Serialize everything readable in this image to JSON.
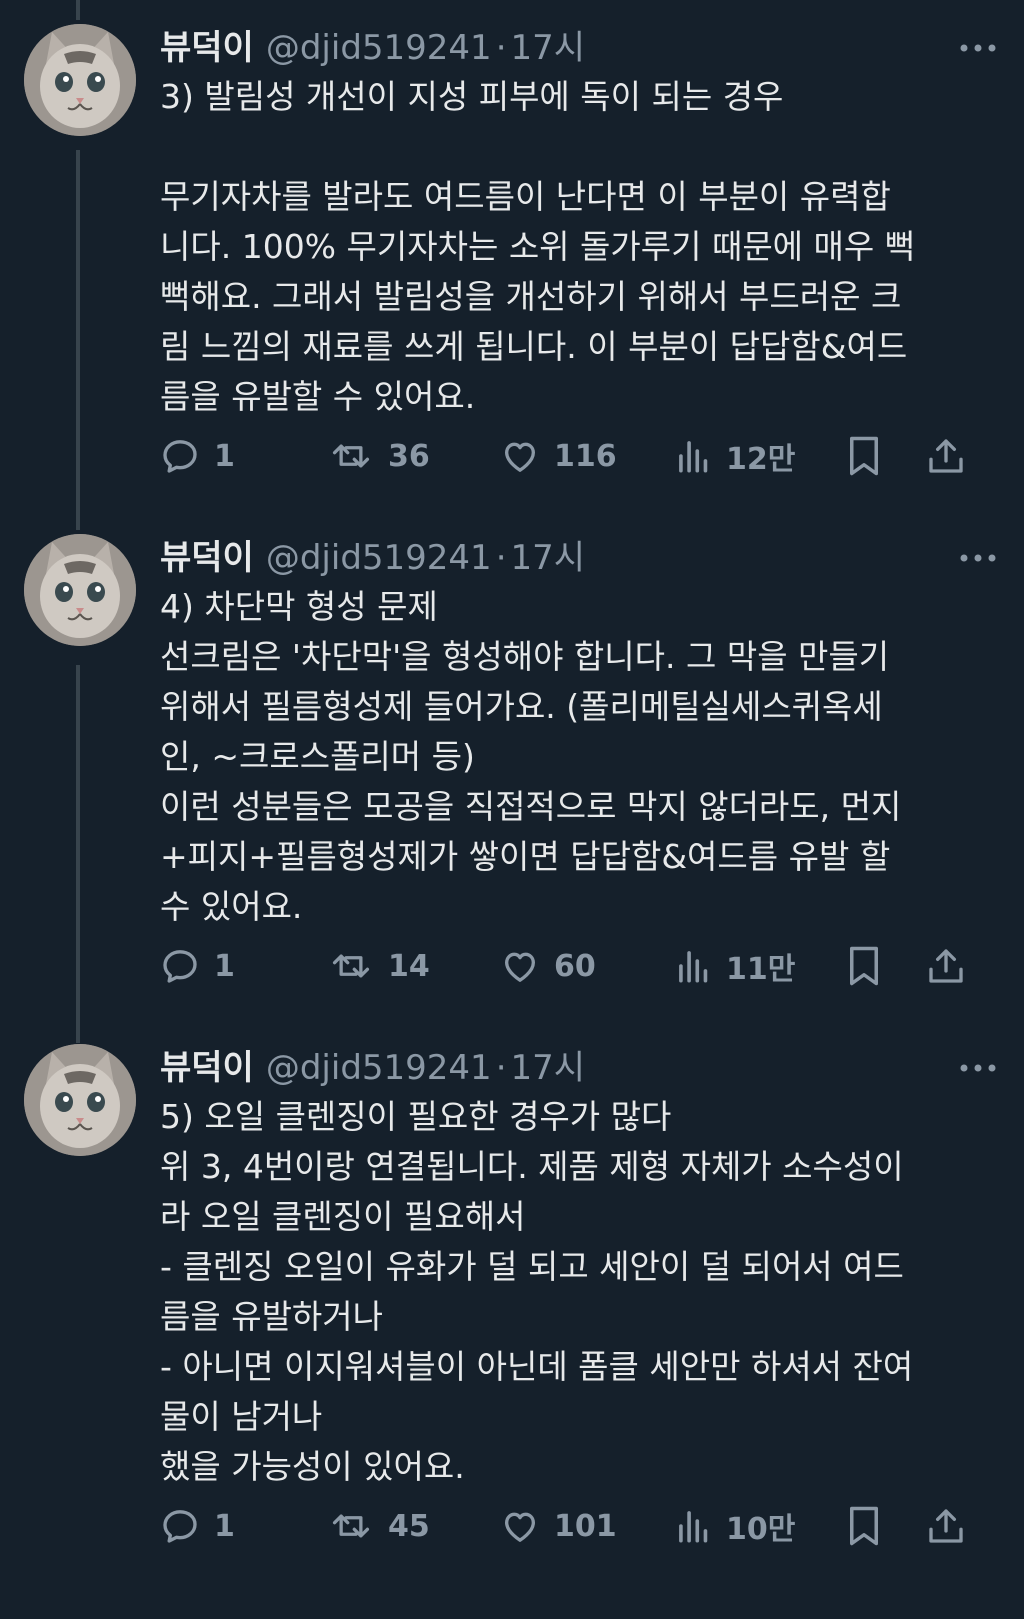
{
  "tweets": [
    {
      "author": {
        "name": "뷰덕이",
        "handle": "@djid519241"
      },
      "separator": "·",
      "time": "17시",
      "body": "3) 발림성 개선이 지성 피부에 독이 되는 경우\n\n무기자차를 발라도 여드름이 난다면 이 부분이 유력합\n니다. 100% 무기자차는 소위 돌가루기 때문에 매우 뻑\n뻑해요. 그래서 발림성을 개선하기 위해서 부드러운 크\n림 느낌의 재료를 쓰게 됩니다. 이 부분이 답답함&여드\n름을 유발할 수 있어요.",
      "stats": {
        "replies": "1",
        "retweets": "36",
        "likes": "116",
        "views": "12만"
      }
    },
    {
      "author": {
        "name": "뷰덕이",
        "handle": "@djid519241"
      },
      "separator": "·",
      "time": "17시",
      "body": "4) 차단막 형성 문제\n선크림은 '차단막'을 형성해야 합니다. 그 막을 만들기\n위해서 필름형성제 들어가요. (폴리메틸실세스퀴옥세\n인, ~크로스폴리머 등)\n이런 성분들은 모공을 직접적으로 막지 않더라도, 먼지\n+피지+필름형성제가 쌓이면 답답함&여드름 유발 할\n수 있어요.",
      "stats": {
        "replies": "1",
        "retweets": "14",
        "likes": "60",
        "views": "11만"
      }
    },
    {
      "author": {
        "name": "뷰덕이",
        "handle": "@djid519241"
      },
      "separator": "·",
      "time": "17시",
      "body": "5) 오일 클렌징이 필요한 경우가 많다\n위 3, 4번이랑 연결됩니다. 제품 제형 자체가 소수성이\n라 오일 클렌징이 필요해서\n- 클렌징 오일이 유화가 덜 되고 세안이 덜 되어서 여드\n름을 유발하거나\n- 아니면 이지워셔블이 아닌데 폼클 세안만 하셔서 잔여\n물이 남거나\n했을 가능성이 있어요.",
      "stats": {
        "replies": "1",
        "retweets": "45",
        "likes": "101",
        "views": "10만"
      }
    }
  ],
  "colors": {
    "background": "#15202b",
    "text": "#e7e9ea",
    "secondary": "#8b98a5",
    "thread_line": "#38444d"
  },
  "icons": [
    "more-icon",
    "reply-icon",
    "retweet-icon",
    "like-icon",
    "views-icon",
    "bookmark-icon",
    "share-icon",
    "avatar-cat"
  ]
}
